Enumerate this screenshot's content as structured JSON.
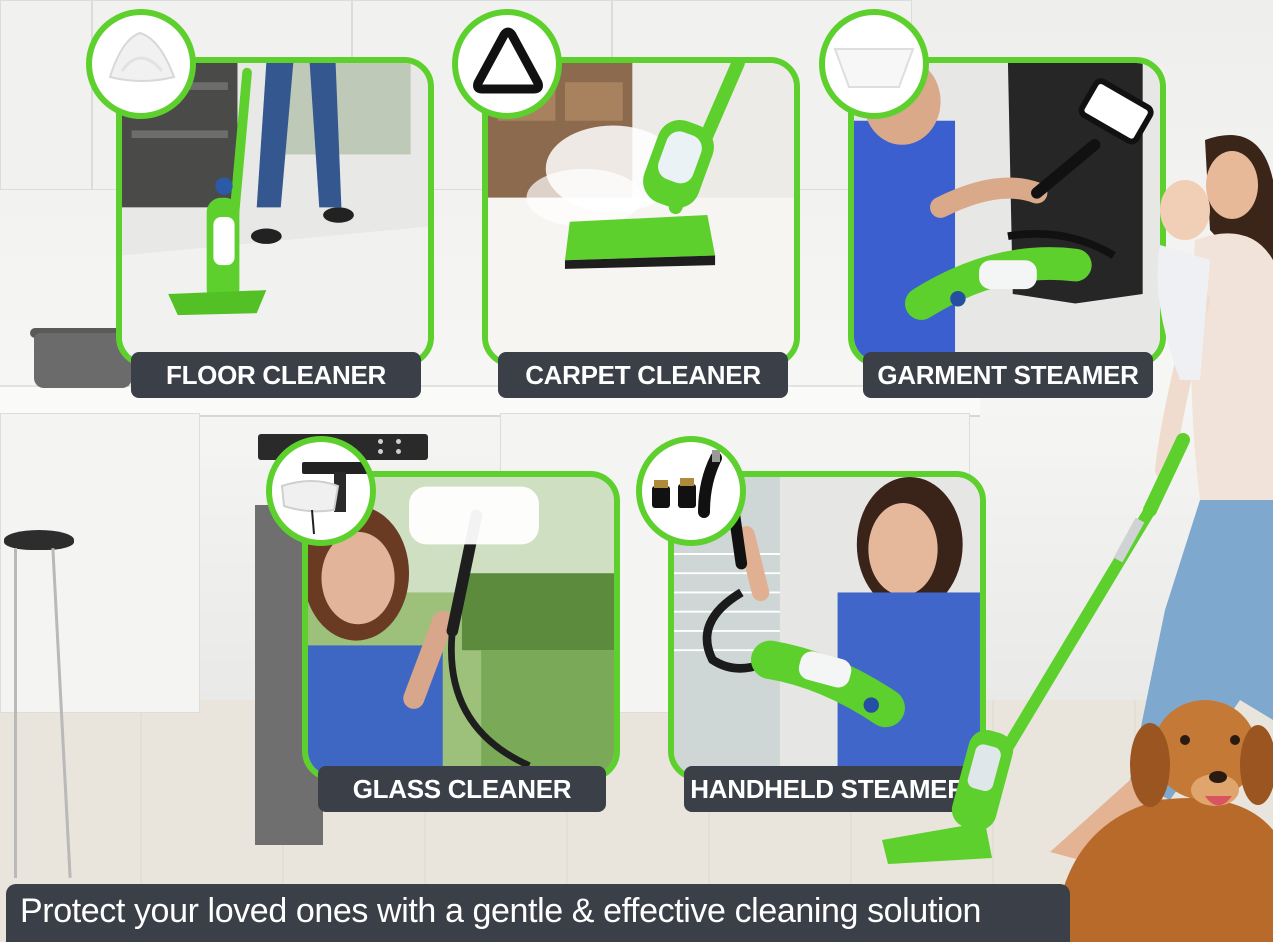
{
  "features": [
    {
      "id": "floor",
      "label": "FLOOR CLEANER",
      "accessory": "triangle-mop-pad-icon"
    },
    {
      "id": "carpet",
      "label": "CARPET CLEANER",
      "accessory": "carpet-glider-icon"
    },
    {
      "id": "garment",
      "label": "GARMENT STEAMER",
      "accessory": "fabric-pad-icon"
    },
    {
      "id": "glass",
      "label": "GLASS CLEANER",
      "accessory": "window-squeegee-icon"
    },
    {
      "id": "handheld",
      "label": "HANDHELD STEAMER",
      "accessory": "brush-nozzle-set-icon"
    }
  ],
  "tagline": "Protect your loved ones with a gentle & effective cleaning solution",
  "colors": {
    "accent_green": "#5ed02e",
    "label_bg": "#3b3f48",
    "label_text": "#ffffff"
  }
}
